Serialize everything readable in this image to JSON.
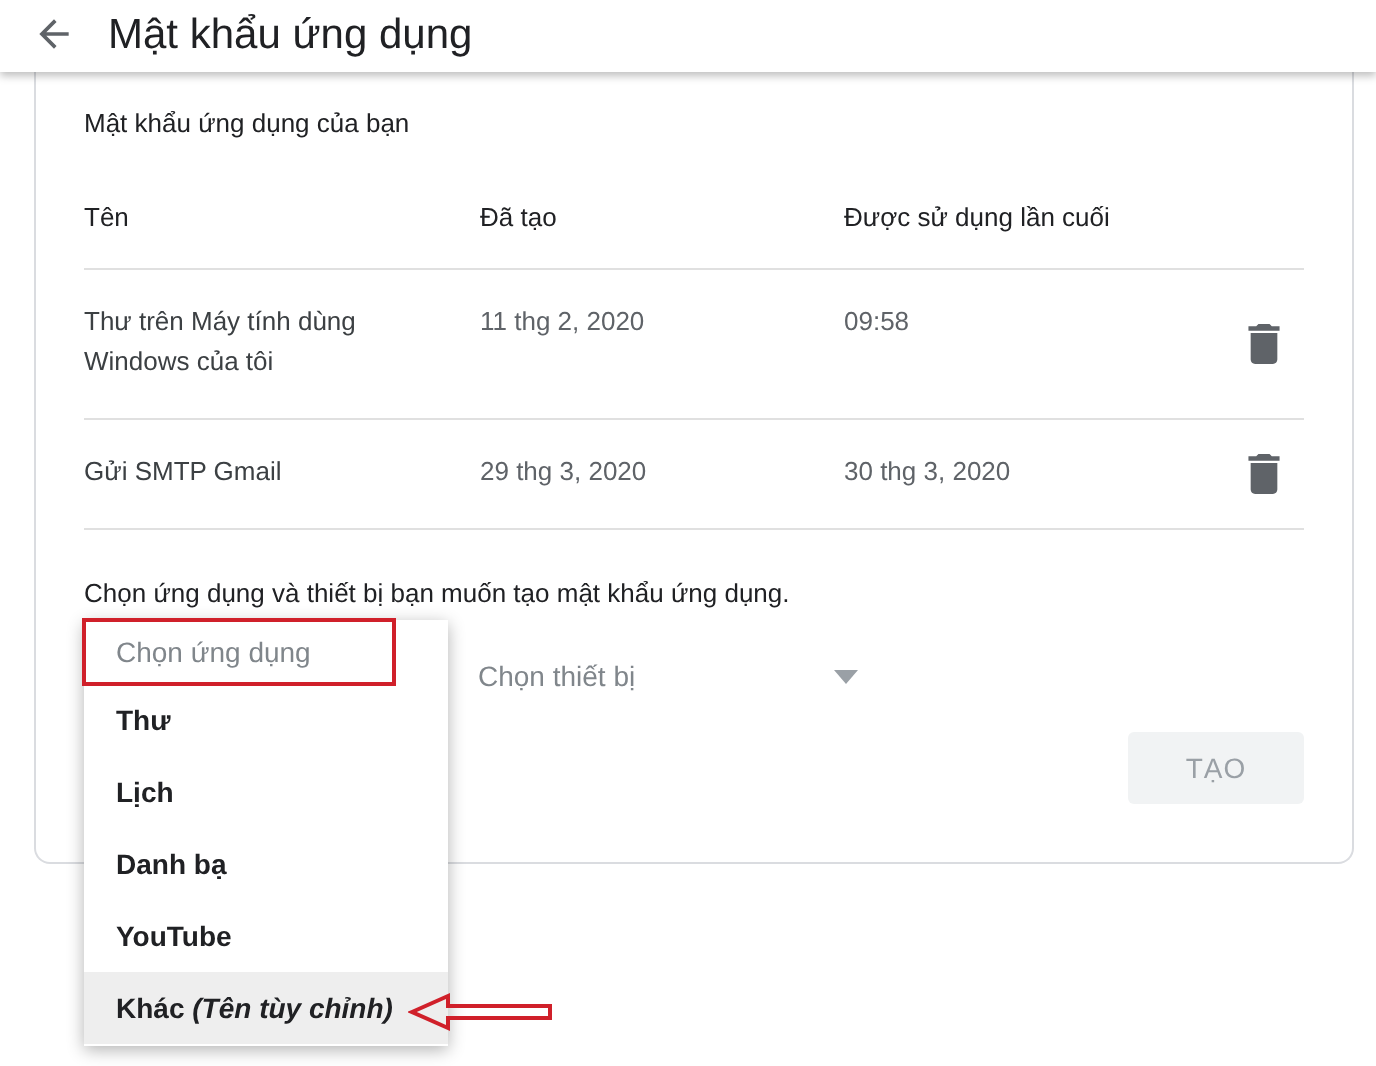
{
  "header": {
    "title": "Mật khẩu ứng dụng"
  },
  "card": {
    "title": "Mật khẩu ứng dụng của bạn",
    "columns": [
      "Tên",
      "Đã tạo",
      "Được sử dụng lần cuối"
    ],
    "rows": [
      {
        "name": "Thư trên Máy tính dùng Windows của tôi",
        "created": "11 thg 2, 2020",
        "last_used": "09:58"
      },
      {
        "name": "Gửi SMTP Gmail",
        "created": "29 thg 3, 2020",
        "last_used": "30 thg 3, 2020"
      }
    ],
    "instruction": "Chọn ứng dụng và thiết bị bạn muốn tạo mật khẩu ứng dụng.",
    "device_select": {
      "placeholder": "Chọn thiết bị"
    },
    "create_button": {
      "label": "TẠO",
      "disabled": true
    }
  },
  "app_menu": {
    "placeholder": "Chọn ứng dụng",
    "items": [
      {
        "label": "Thư",
        "selected": false
      },
      {
        "label": "Lịch",
        "selected": false
      },
      {
        "label": "Danh bạ",
        "selected": false
      },
      {
        "label": "YouTube",
        "selected": false
      },
      {
        "label": "Khác *(Tên tùy chỉnh)*",
        "selected": true
      }
    ]
  }
}
